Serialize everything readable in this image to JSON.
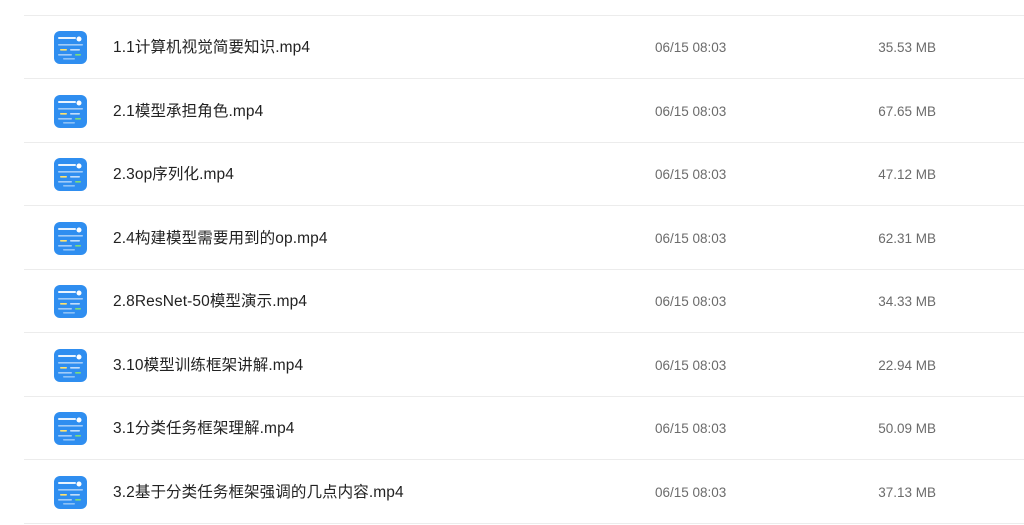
{
  "file_list": {
    "icon": "video-file-icon",
    "colors": {
      "icon_bg": "#2f8ef0",
      "name_text": "#222222",
      "meta_text": "#6b6b6b",
      "divider": "#ececec"
    },
    "rows": [
      {
        "name": "1.1计算机视觉简要知识.mp4",
        "date": "06/15 08:03",
        "size": "35.53 MB"
      },
      {
        "name": "2.1模型承担角色.mp4",
        "date": "06/15 08:03",
        "size": "67.65 MB"
      },
      {
        "name": "2.3op序列化.mp4",
        "date": "06/15 08:03",
        "size": "47.12 MB"
      },
      {
        "name": "2.4构建模型需要用到的op.mp4",
        "date": "06/15 08:03",
        "size": "62.31 MB"
      },
      {
        "name": "2.8ResNet-50模型演示.mp4",
        "date": "06/15 08:03",
        "size": "34.33 MB"
      },
      {
        "name": "3.10模型训练框架讲解.mp4",
        "date": "06/15 08:03",
        "size": "22.94 MB"
      },
      {
        "name": "3.1分类任务框架理解.mp4",
        "date": "06/15 08:03",
        "size": "50.09 MB"
      },
      {
        "name": "3.2基于分类任务框架强调的几点内容.mp4",
        "date": "06/15 08:03",
        "size": "37.13 MB"
      }
    ]
  }
}
